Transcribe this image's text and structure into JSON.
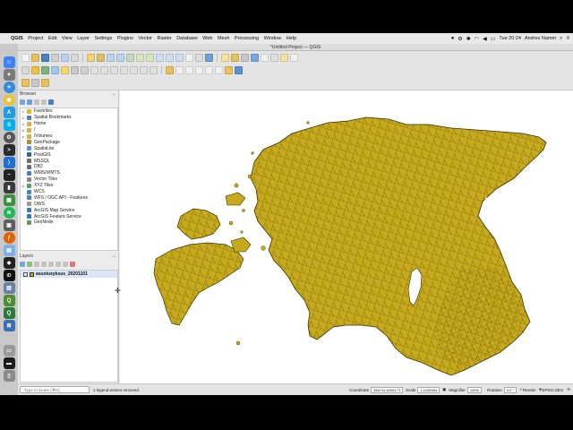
{
  "menubar": {
    "app": "QGIS",
    "items": [
      "Project",
      "Edit",
      "View",
      "Layer",
      "Settings",
      "Plugins",
      "Vector",
      "Raster",
      "Database",
      "Web",
      "Mesh",
      "Processing",
      "Window",
      "Help"
    ],
    "clock": "Tue 20:24",
    "user": "Andres Namm"
  },
  "window": {
    "title": "*Untitled Project — QGIS"
  },
  "browser": {
    "title": "Browser",
    "items": [
      {
        "label": "Favorites",
        "icon": "star-icon",
        "color": "#e7b416"
      },
      {
        "label": "Spatial Bookmarks",
        "icon": "bookmark-icon",
        "color": "#4a7fc1"
      },
      {
        "label": "Home",
        "icon": "home-folder-icon",
        "color": "#d8b04a"
      },
      {
        "label": "/",
        "icon": "folder-icon",
        "color": "#d8b04a"
      },
      {
        "label": "/Volumes",
        "icon": "folder-icon",
        "color": "#d8b04a"
      },
      {
        "label": "GeoPackage",
        "icon": "geopackage-icon",
        "color": "#b08a3a"
      },
      {
        "label": "SpatiaLite",
        "icon": "spatialite-icon",
        "color": "#5b8fd6"
      },
      {
        "label": "PostGIS",
        "icon": "postgis-icon",
        "color": "#336791"
      },
      {
        "label": "MSSQL",
        "icon": "mssql-icon",
        "color": "#6d6d6d"
      },
      {
        "label": "DB2",
        "icon": "db2-icon",
        "color": "#6d6d6d"
      },
      {
        "label": "WMS/WMTS",
        "icon": "wms-icon",
        "color": "#4a7fc1"
      },
      {
        "label": "Vector Tiles",
        "icon": "vector-tiles-icon",
        "color": "#8a8a8a"
      },
      {
        "label": "XYZ Tiles",
        "icon": "xyz-tiles-icon",
        "color": "#5aa05a"
      },
      {
        "label": "WCS",
        "icon": "wcs-icon",
        "color": "#4a7fc1"
      },
      {
        "label": "WFS / OGC API - Features",
        "icon": "wfs-icon",
        "color": "#4a7fc1"
      },
      {
        "label": "OWS",
        "icon": "ows-icon",
        "color": "#9a9a9a"
      },
      {
        "label": "ArcGIS Map Service",
        "icon": "arcgis-map-icon",
        "color": "#3c7ab5"
      },
      {
        "label": "ArcGIS Feature Service",
        "icon": "arcgis-feature-icon",
        "color": "#3c7ab5"
      },
      {
        "label": "GeoNode",
        "icon": "geonode-icon",
        "color": "#5c9c5c"
      }
    ]
  },
  "layers": {
    "title": "Layers",
    "items": [
      {
        "name": "asustusyksus_20201101",
        "checked": true,
        "fill": "#c6a91c"
      }
    ]
  },
  "map": {
    "fill": "#c6a91c",
    "stroke": "#3a3000",
    "background": "#ffffff"
  },
  "status": {
    "locator_placeholder": "Type to locate (⌘K)",
    "message": "1 legend entries removed.",
    "coordinate_label": "Coordinate",
    "coordinate_value": "356716,6498173",
    "scale_label": "Scale",
    "scale_value": "1:1196384",
    "magnifier_label": "Magnifier",
    "magnifier_value": "100%",
    "rotation_label": "Rotation",
    "rotation_value": "0.0 °",
    "render_label": "Render",
    "crs_label": "EPSG:3301"
  }
}
